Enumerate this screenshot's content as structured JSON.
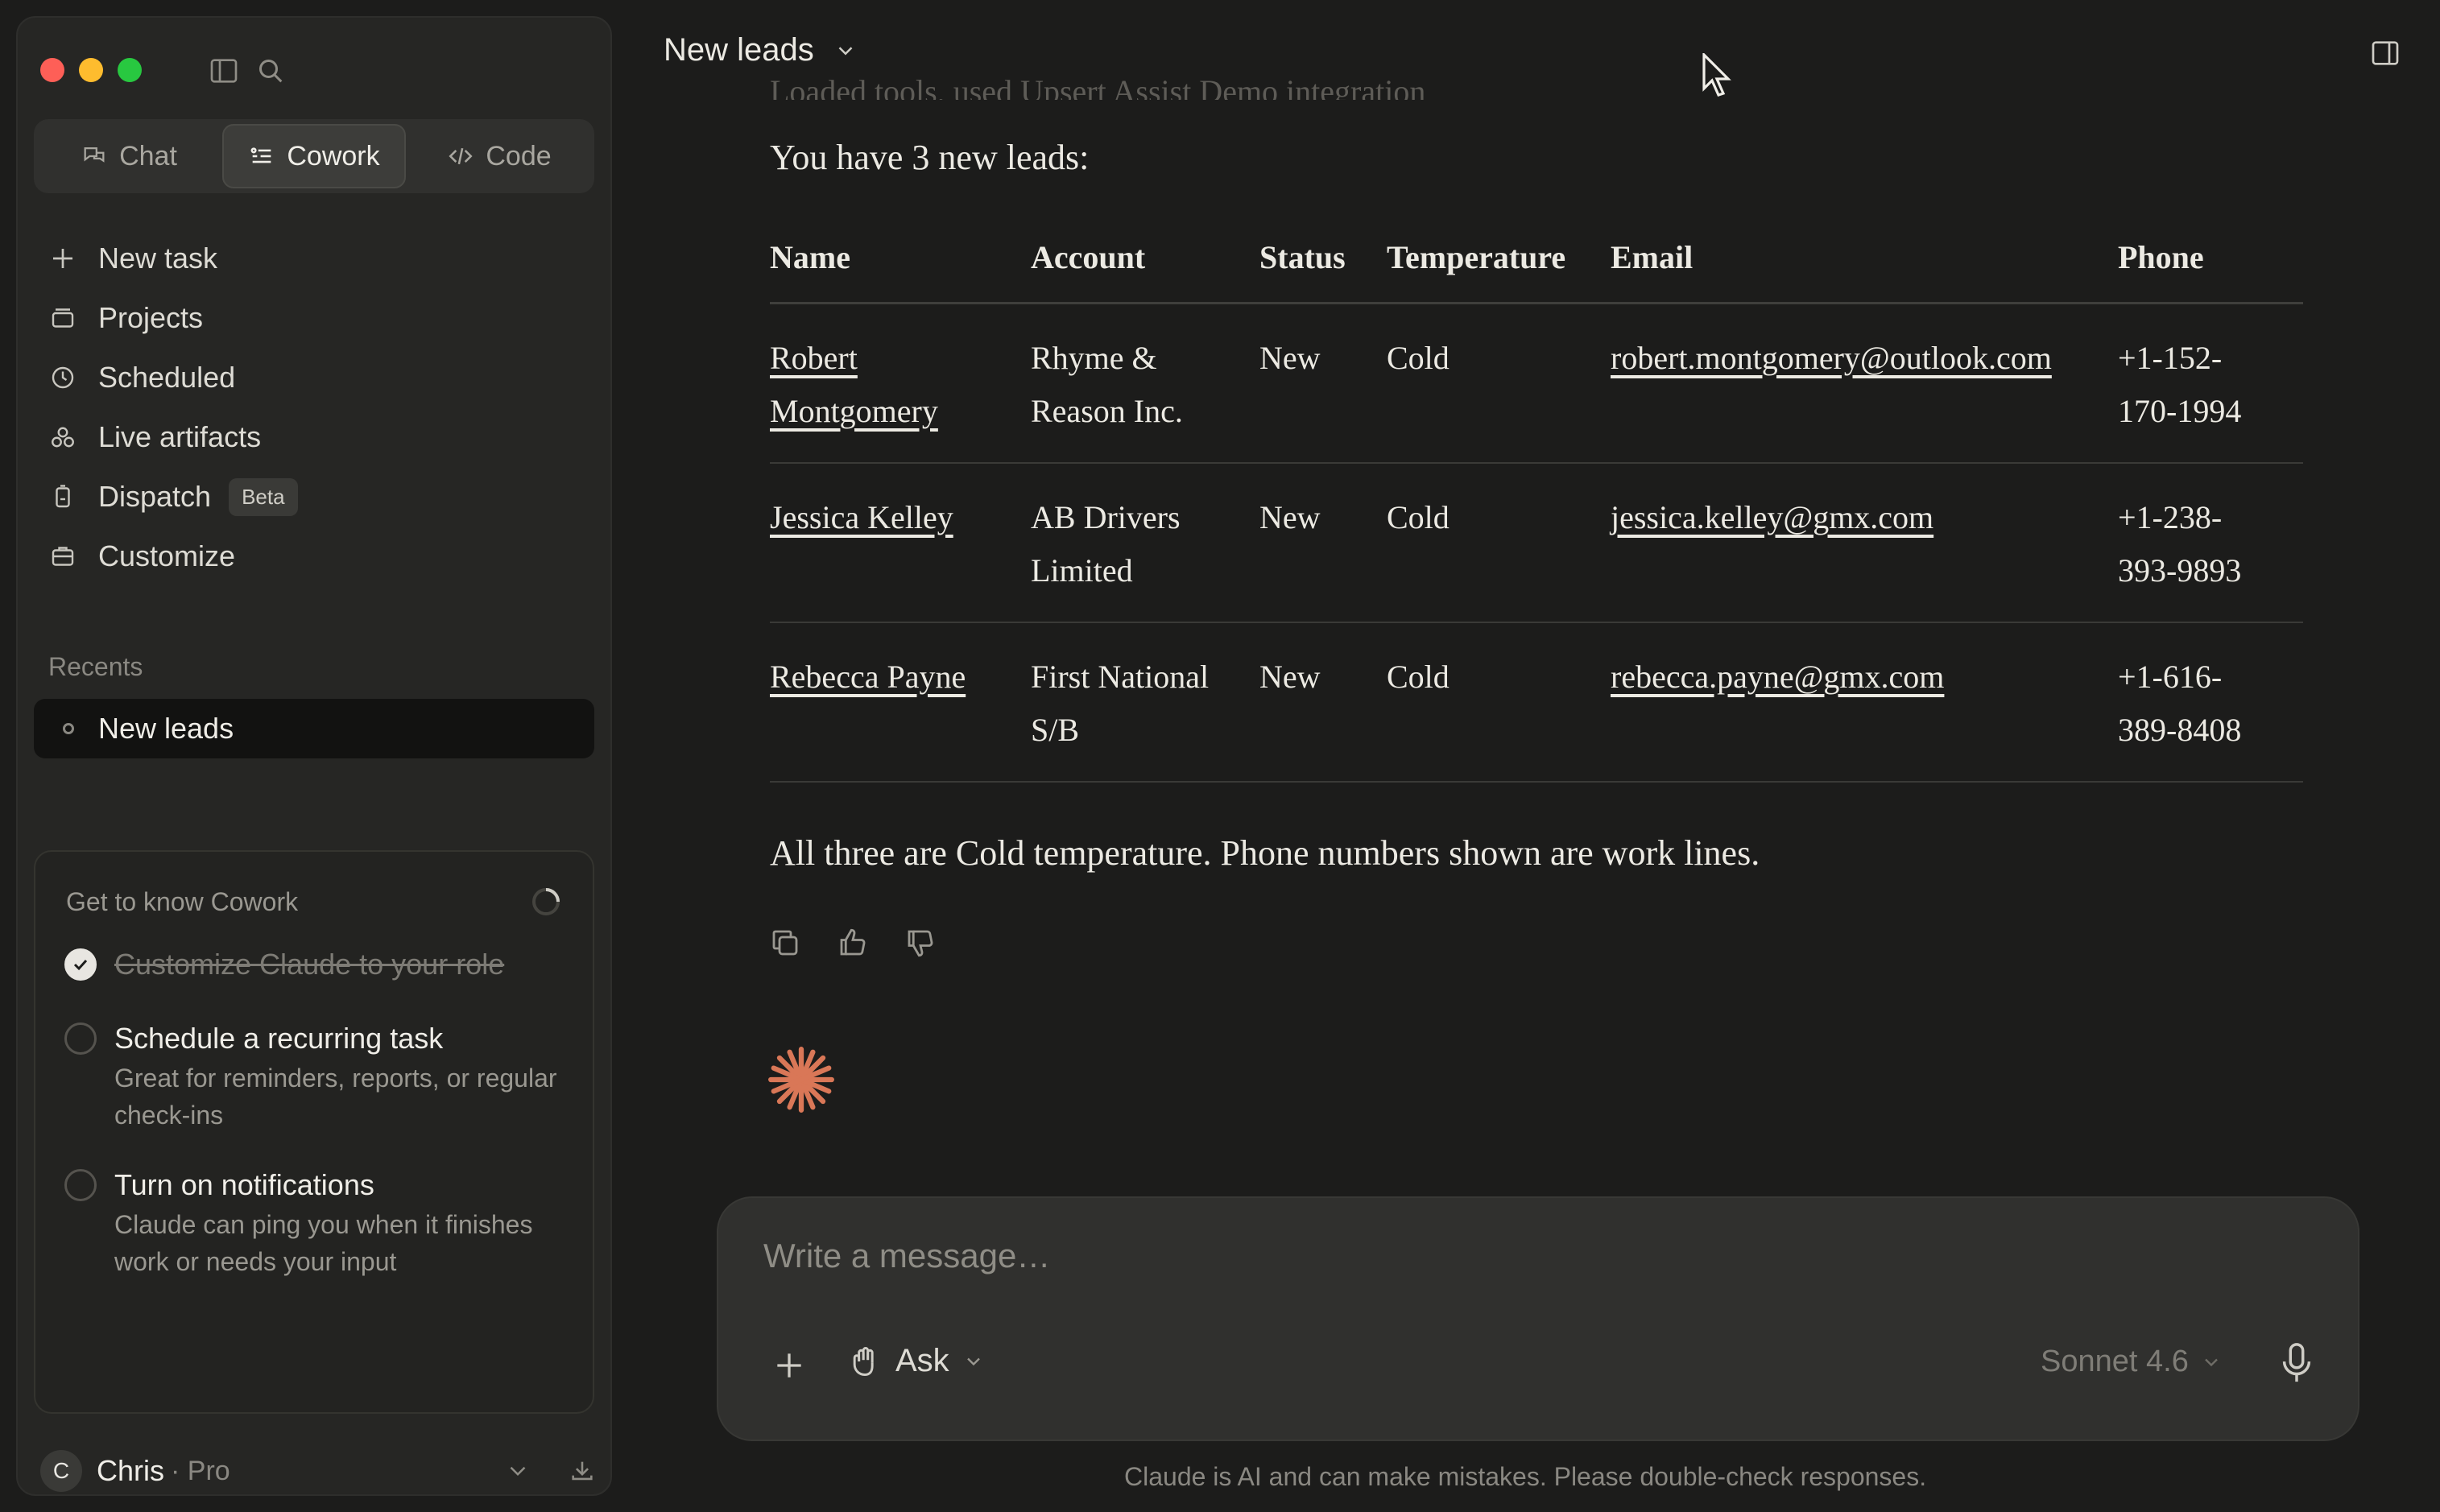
{
  "sidebar": {
    "mode_tabs": [
      {
        "label": "Chat",
        "icon": "chat-bubbles-icon",
        "active": false
      },
      {
        "label": "Cowork",
        "icon": "cowork-icon",
        "active": true
      },
      {
        "label": "Code",
        "icon": "code-brackets-icon",
        "active": false
      }
    ],
    "nav": {
      "new_task": "New task",
      "projects": "Projects",
      "scheduled": "Scheduled",
      "live_artifacts": "Live artifacts",
      "dispatch": "Dispatch",
      "dispatch_badge": "Beta",
      "customize": "Customize"
    },
    "recents_label": "Recents",
    "recents": [
      {
        "label": "New leads"
      }
    ],
    "know_card": {
      "title": "Get to know Cowork",
      "tasks": [
        {
          "title": "Customize Claude to your role",
          "done": true,
          "desc": ""
        },
        {
          "title": "Schedule a recurring task",
          "done": false,
          "desc": "Great for reminders, reports, or regular check-ins"
        },
        {
          "title": "Turn on notifications",
          "done": false,
          "desc": "Claude can ping you when it finishes work or needs your input"
        }
      ]
    },
    "user": {
      "initial": "C",
      "name": "Chris",
      "plan": "· Pro"
    }
  },
  "header": {
    "title": "New leads"
  },
  "conversation": {
    "ghost_line": "Loaded tools, used Upsert Assist Demo integration",
    "intro": "You have 3 new leads:",
    "table": {
      "headers": [
        "Name",
        "Account",
        "Status",
        "Temperature",
        "Email",
        "Phone"
      ],
      "rows": [
        {
          "name_1": "Robert",
          "name_2": "Montgomery",
          "account_1": "Rhyme &",
          "account_2": "Reason Inc.",
          "status": "New",
          "temperature": "Cold",
          "email": "robert.montgomery@outlook.com",
          "phone_1": "+1-152-",
          "phone_2": "170-1994"
        },
        {
          "name_1": "Jessica Kelley",
          "name_2": "",
          "account_1": "AB Drivers",
          "account_2": "Limited",
          "status": "New",
          "temperature": "Cold",
          "email": "jessica.kelley@gmx.com",
          "phone_1": "+1-238-",
          "phone_2": "393-9893"
        },
        {
          "name_1": "Rebecca Payne",
          "name_2": "",
          "account_1": "First National",
          "account_2": "S/B",
          "status": "New",
          "temperature": "Cold",
          "email": "rebecca.payne@gmx.com",
          "phone_1": "+1-616-",
          "phone_2": "389-8408"
        }
      ]
    },
    "summary": "All three are Cold temperature. Phone numbers shown are work lines."
  },
  "composer": {
    "placeholder": "Write a message…",
    "mode": "Ask",
    "model": "Sonnet 4.6"
  },
  "disclaimer": "Claude is AI and can make mistakes. Please double-check responses.",
  "colors": {
    "accent": "#d97757",
    "background": "#1c1c1b",
    "sidebar": "#262624"
  }
}
